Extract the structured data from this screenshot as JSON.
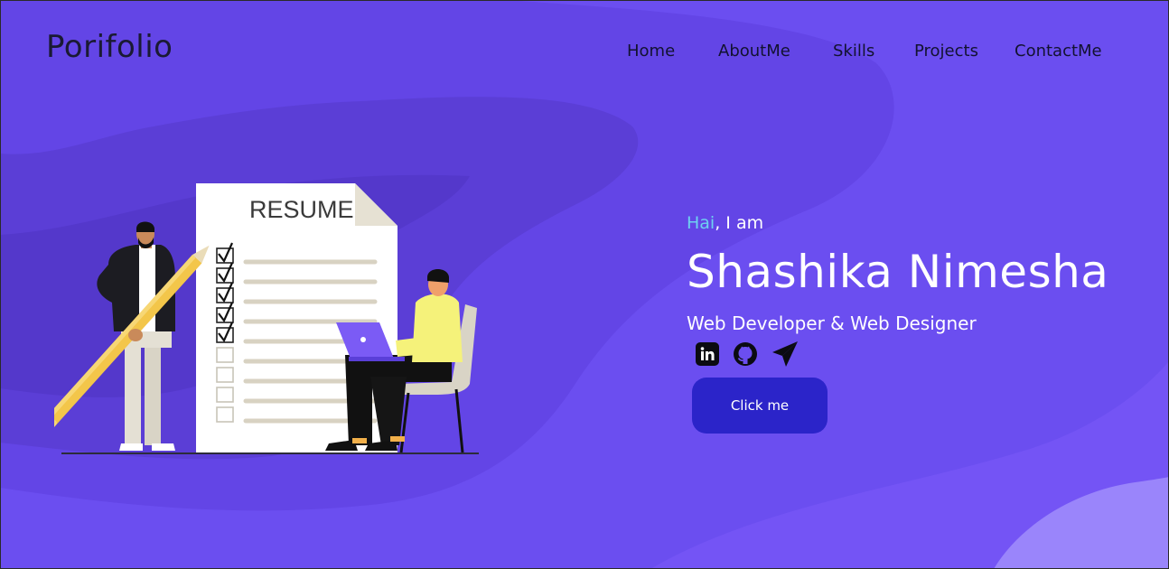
{
  "header": {
    "logo": "Porifolio",
    "nav": [
      "Home",
      "AboutMe",
      "Skills",
      "Projects",
      "ContactMe"
    ]
  },
  "illustration": {
    "resume_title": "RESUME"
  },
  "hero": {
    "greeting_highlight": "Hai",
    "greeting_rest": ", I am",
    "name": "Shashika Nimesha",
    "role": "Web Developer & Web Designer",
    "cta_label": "Click me"
  },
  "socials": [
    {
      "icon": "linkedin-icon"
    },
    {
      "icon": "github-icon"
    },
    {
      "icon": "telegram-icon"
    }
  ],
  "colors": {
    "background": "#6b4ef0",
    "accent_greeting": "#6ed1f0",
    "button": "#2b24c9",
    "shirt": "#f5f27a"
  }
}
